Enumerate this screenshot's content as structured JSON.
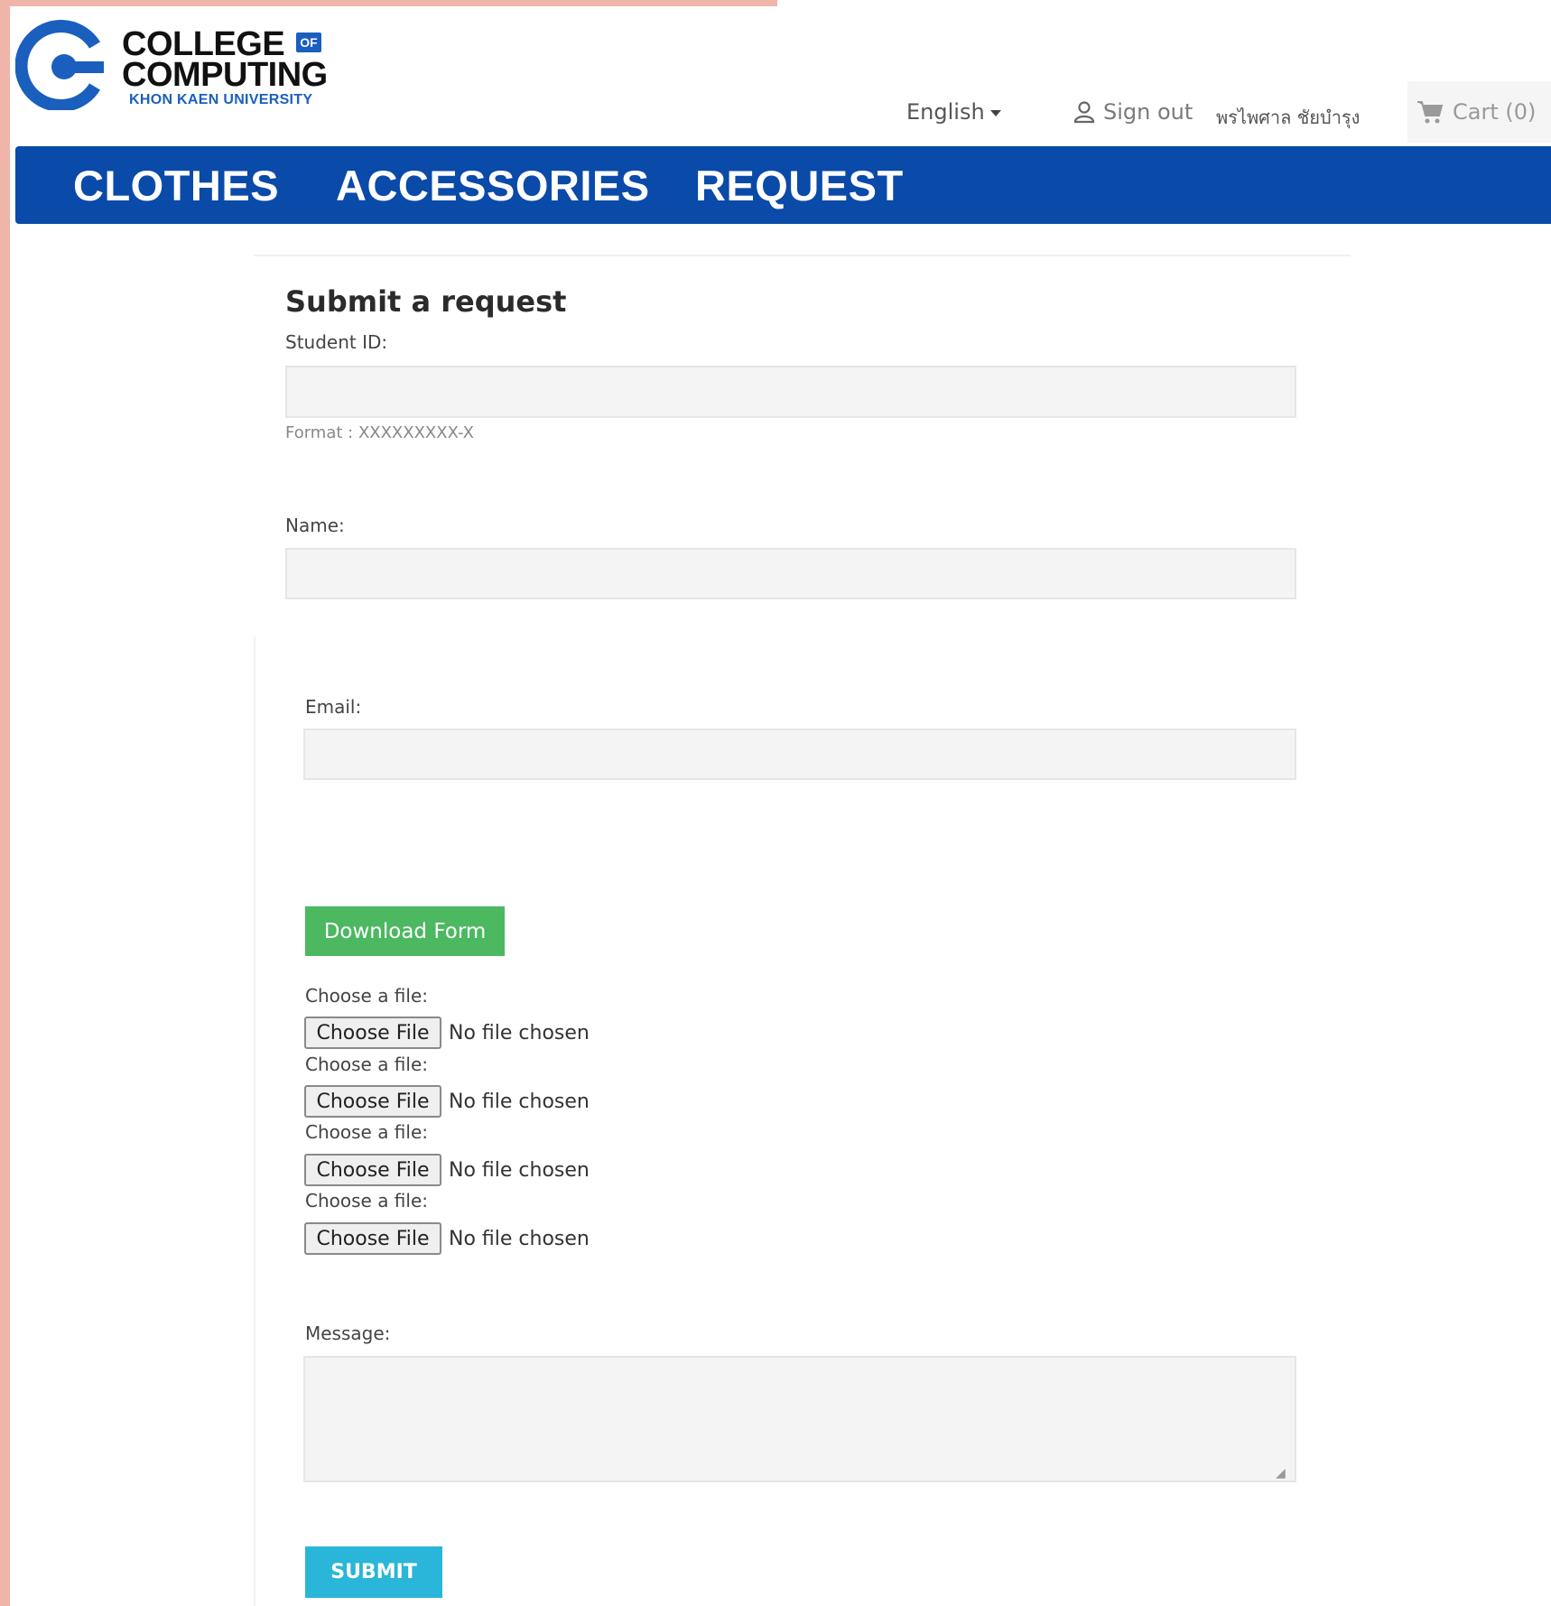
{
  "logo": {
    "line1": "COLLEGE",
    "of": "OF",
    "line2": "COMPUTING",
    "sub": "KHON KAEN UNIVERSITY",
    "brand_color": "#1a5fbe"
  },
  "header": {
    "language": "English",
    "sign_out": "Sign out",
    "user_name": "พรไพศาล ชัยบำรุง",
    "cart": "Cart (0)"
  },
  "nav": {
    "items": [
      {
        "label": "CLOTHES"
      },
      {
        "label": "ACCESSORIES"
      },
      {
        "label": "REQUEST"
      }
    ],
    "color": "#0a4aa8"
  },
  "form": {
    "title": "Submit a request",
    "student_id_label": "Student ID:",
    "student_id_value": "",
    "student_id_hint": "Format : XXXXXXXXX-X",
    "name_label": "Name:",
    "name_value": "",
    "email_label": "Email:",
    "email_value": "",
    "download_button": "Download Form",
    "file_inputs": [
      {
        "label": "Choose a file:",
        "button": "Choose File",
        "status": "No file chosen"
      },
      {
        "label": "Choose a file:",
        "button": "Choose File",
        "status": "No file chosen"
      },
      {
        "label": "Choose a file:",
        "button": "Choose File",
        "status": "No file chosen"
      },
      {
        "label": "Choose a file:",
        "button": "Choose File",
        "status": "No file chosen"
      }
    ],
    "message_label": "Message:",
    "message_value": "",
    "submit_button": "SUBMIT"
  },
  "colors": {
    "download_button": "#4cb860",
    "submit_button": "#29b6d8",
    "background_accent": "#efb5a9"
  }
}
